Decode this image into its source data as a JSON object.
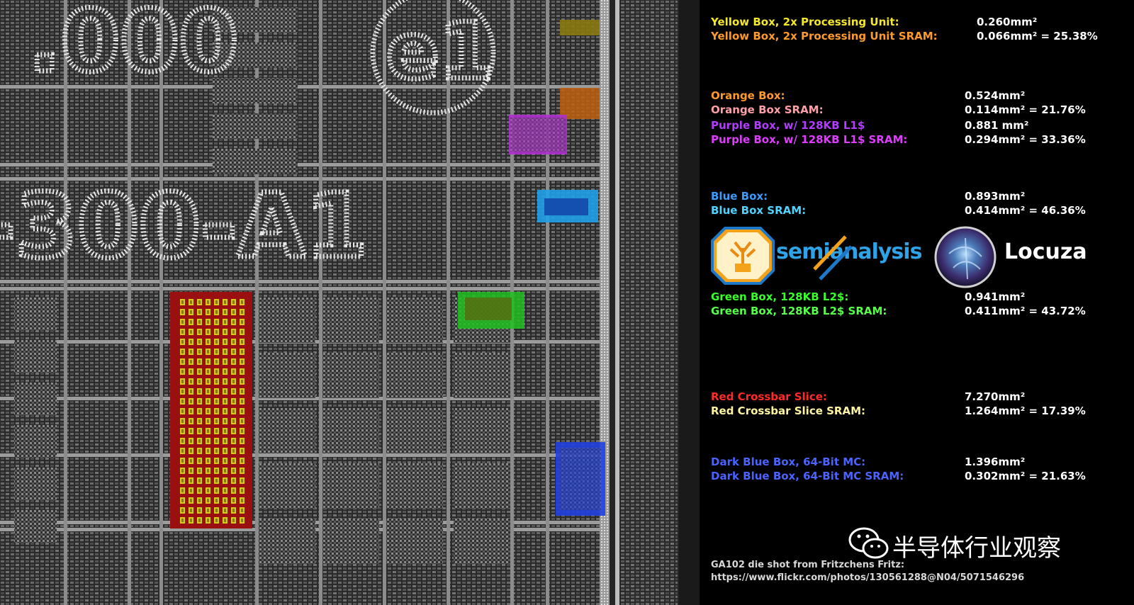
{
  "panel": {
    "rows": [
      {
        "label": "Yellow Box, 2x Processing Unit:",
        "value": "0.260mm²",
        "label_color": "#f5e72a",
        "value_color": "#ffffff"
      },
      {
        "label": "Yellow Box, 2x Processing Unit SRAM:",
        "value": "0.066mm² = 25.38%",
        "label_color": "#ff9a2a",
        "value_color": "#ffffff"
      },
      {
        "label": "Orange Box:",
        "value": "0.524mm²",
        "label_color": "#ff9a2a",
        "value_color": "#ffffff"
      },
      {
        "label": "Orange Box SRAM:",
        "value": "0.114mm² = 21.76%",
        "label_color": "#ff9fa6",
        "value_color": "#ffffff"
      },
      {
        "label": "Purple Box, w/ 128KB L1$",
        "value": "0.881 mm²",
        "label_color": "#b23cff",
        "value_color": "#ffffff"
      },
      {
        "label": "Purple Box, w/ 128KB L1$ SRAM:",
        "value": "0.294mm² = 33.36%",
        "label_color": "#e03cff",
        "value_color": "#ffffff"
      },
      {
        "label": "Blue Box:",
        "value": "0.893mm²",
        "label_color": "#3b9cff",
        "value_color": "#ffffff"
      },
      {
        "label": "Blue Box SRAM:",
        "value": "0.414mm² = 46.36%",
        "label_color": "#4fd3ff",
        "value_color": "#ffffff"
      },
      {
        "label": "Green Box, 128KB L2$:",
        "value": "0.941mm²",
        "label_color": "#38ff2a",
        "value_color": "#ffffff"
      },
      {
        "label": "Green Box, 128KB L2$ SRAM:",
        "value": "0.411mm² = 43.72%",
        "label_color": "#56ff4a",
        "value_color": "#ffffff"
      },
      {
        "label": "Red Crossbar Slice:",
        "value": "7.270mm²",
        "label_color": "#ff2a2a",
        "value_color": "#ffffff"
      },
      {
        "label": "Red Crossbar Slice SRAM:",
        "value": "1.264mm² = 17.39%",
        "label_color": "#fff4a0",
        "value_color": "#ffffff"
      },
      {
        "label": "Dark Blue Box, 64-Bit MC:",
        "value": "1.396mm²",
        "label_color": "#4b63ff",
        "value_color": "#ffffff"
      },
      {
        "label": "Dark Blue Box, 64-Bit MC SRAM:",
        "value": "0.302mm² = 21.63%",
        "label_color": "#4b63ff",
        "value_color": "#ffffff"
      }
    ]
  },
  "logos": {
    "semianalysis": "semianalysis",
    "locuza": "Locuza"
  },
  "watermark": {
    "text": "半导体行业观察",
    "icon": "wechat-icon"
  },
  "credit": {
    "line1": "GA102 die shot from Fritzchens Fritz:",
    "line2": "https://www.flickr.com/photos/130561288@N04/5071546296"
  },
  "die": {
    "markings": [
      ".000",
      "e1",
      "-300-A1"
    ],
    "region_colors": {
      "yellow": "#8a7a10",
      "orange": "#c06010",
      "purple": "#b030d0",
      "blue": "#2090e0",
      "green": "#20c020",
      "red": "#b01010",
      "dark_blue": "#2040e0"
    }
  }
}
